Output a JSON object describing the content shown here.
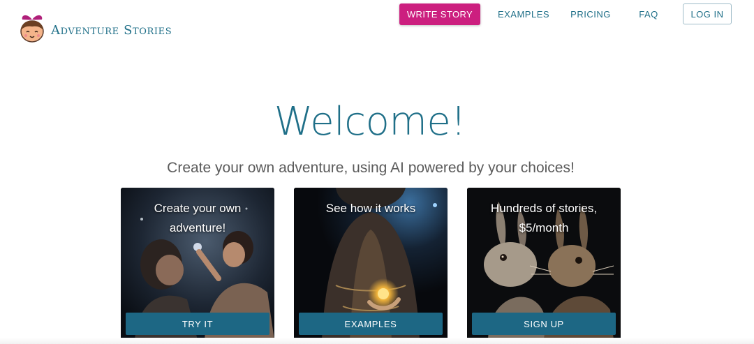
{
  "header": {
    "logo_text": "Adventure Stories",
    "logo_icon": "smiling-kid-icon"
  },
  "nav": {
    "write_story": "WRITE STORY",
    "examples": "EXAMPLES",
    "pricing": "PRICING",
    "faq": "FAQ",
    "login": "LOG IN"
  },
  "hero": {
    "title": "Welcome!",
    "subtitle": "Create your own adventure, using AI powered by your choices!"
  },
  "cards": [
    {
      "text": "Create your own adventure!",
      "button": "TRY IT",
      "image": "mother-and-child-forest-image"
    },
    {
      "text": "See how it works",
      "button": "EXAMPLES",
      "image": "hooded-wizard-orb-image"
    },
    {
      "text": "Hundreds of stories, $5/month",
      "button": "SIGN UP",
      "image": "rabbits-portrait-image"
    }
  ],
  "colors": {
    "accent": "#cc1f7f",
    "brand": "#1f6f88",
    "button": "#1d6784"
  }
}
